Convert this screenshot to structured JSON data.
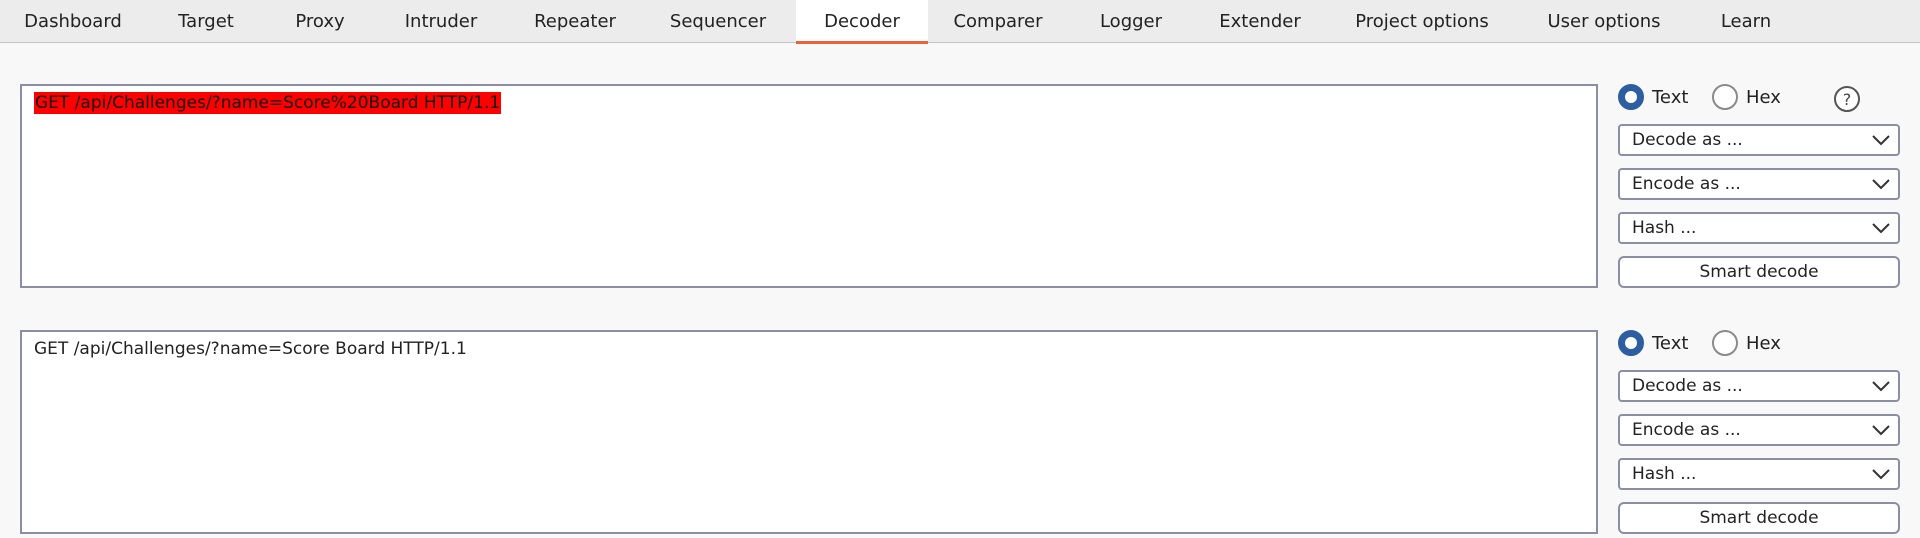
{
  "tabs": [
    {
      "label": "Dashboard"
    },
    {
      "label": "Target"
    },
    {
      "label": "Proxy"
    },
    {
      "label": "Intruder"
    },
    {
      "label": "Repeater"
    },
    {
      "label": "Sequencer"
    },
    {
      "label": "Decoder"
    },
    {
      "label": "Comparer"
    },
    {
      "label": "Logger"
    },
    {
      "label": "Extender"
    },
    {
      "label": "Project options"
    },
    {
      "label": "User options"
    },
    {
      "label": "Learn"
    }
  ],
  "active_tab": "Decoder",
  "panels": [
    {
      "text": "GET /api/Challenges/?name=Score%20Board HTTP/1.1",
      "text_selected": true,
      "mode_text_label": "Text",
      "mode_hex_label": "Hex",
      "selected_mode": "Text",
      "decode_label": "Decode as ...",
      "encode_label": "Encode as ...",
      "hash_label": "Hash ...",
      "smart_decode_label": "Smart decode",
      "help_symbol": "?"
    },
    {
      "text": "GET /api/Challenges/?name=Score Board HTTP/1.1",
      "text_selected": false,
      "mode_text_label": "Text",
      "mode_hex_label": "Hex",
      "selected_mode": "Text",
      "decode_label": "Decode as ...",
      "encode_label": "Encode as ...",
      "hash_label": "Hash ...",
      "smart_decode_label": "Smart decode"
    }
  ],
  "colors": {
    "accent_tab_underline": "#e8623a",
    "selection_highlight": "#ff0000",
    "radio_checked": "#2d5fa0"
  }
}
